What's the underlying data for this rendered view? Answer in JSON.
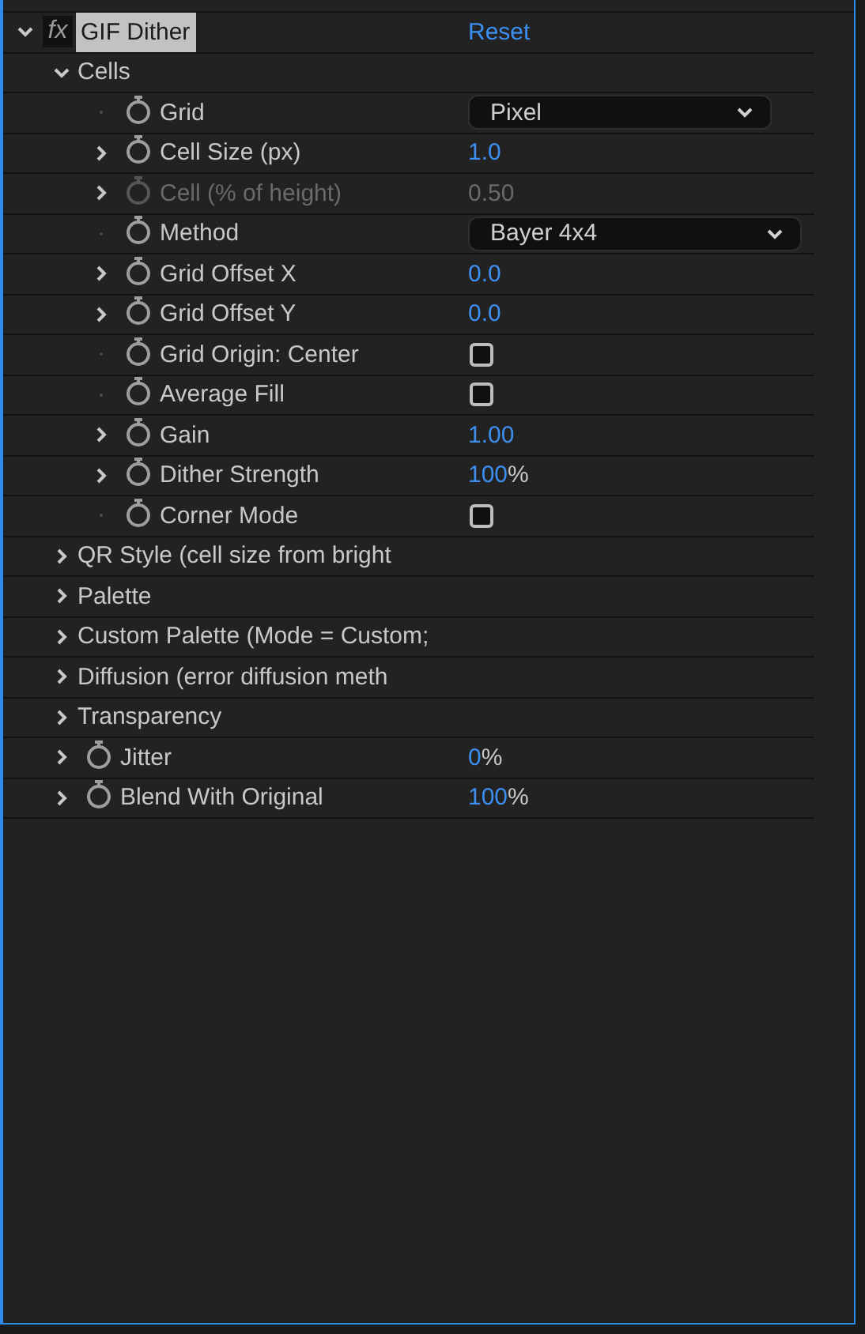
{
  "effect": {
    "badge": "fx",
    "name": "GIF Dither",
    "expanded": true,
    "selected": true,
    "reset": "Reset"
  },
  "items": [
    {
      "kind": "group",
      "label": "Cells",
      "expanded": true,
      "children": [
        {
          "kind": "dropdown",
          "label": "Grid",
          "disabled": false,
          "value": "Pixel"
        },
        {
          "kind": "number",
          "label": "Cell Size (px)",
          "expanded": false,
          "disabled": false,
          "value": "1.0"
        },
        {
          "kind": "number",
          "label": "Cell (% of height)",
          "expanded": false,
          "disabled": true,
          "value": "0.50"
        },
        {
          "kind": "dropdown",
          "label": "Method",
          "disabled": false,
          "value": "Bayer 4x4"
        },
        {
          "kind": "number",
          "label": "Grid Offset X",
          "expanded": false,
          "disabled": false,
          "value": "0.0"
        },
        {
          "kind": "number",
          "label": "Grid Offset Y",
          "expanded": false,
          "disabled": false,
          "value": "0.0"
        },
        {
          "kind": "checkbox",
          "label": "Grid Origin: Center",
          "disabled": false,
          "checked": false
        },
        {
          "kind": "checkbox",
          "label": "Average Fill",
          "disabled": false,
          "checked": false
        },
        {
          "kind": "number",
          "label": "Gain",
          "expanded": false,
          "disabled": false,
          "value": "1.00"
        },
        {
          "kind": "number",
          "label": "Dither Strength",
          "expanded": false,
          "disabled": false,
          "value": "100",
          "unit": "%"
        },
        {
          "kind": "checkbox",
          "label": "Corner Mode",
          "disabled": false,
          "checked": false
        }
      ]
    },
    {
      "kind": "group",
      "label": "QR Style (cell size from bright",
      "expanded": false
    },
    {
      "kind": "group",
      "label": "Palette",
      "expanded": false
    },
    {
      "kind": "group",
      "label": "Custom Palette (Mode = Custom;",
      "expanded": false
    },
    {
      "kind": "group",
      "label": "Diffusion (error diffusion meth",
      "expanded": false
    },
    {
      "kind": "group",
      "label": "Transparency",
      "expanded": false
    },
    {
      "kind": "number",
      "label": "Jitter",
      "expanded": false,
      "disabled": false,
      "value": "0",
      "unit": "%"
    },
    {
      "kind": "number",
      "label": "Blend With Original",
      "expanded": false,
      "disabled": false,
      "value": "100",
      "unit": "%"
    }
  ]
}
